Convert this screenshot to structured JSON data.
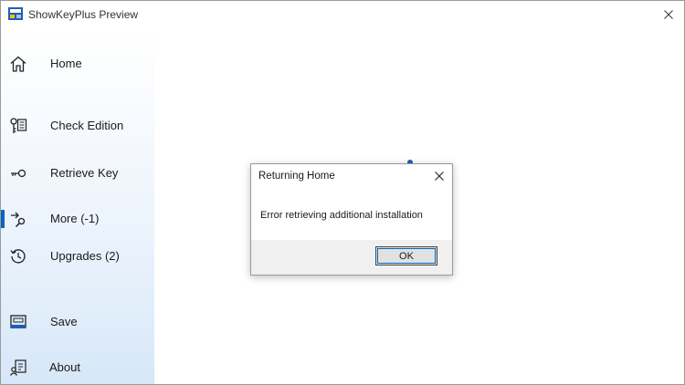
{
  "window": {
    "title": "ShowKeyPlus Preview"
  },
  "sidebar": {
    "items": [
      {
        "label": "Home",
        "icon": "home-icon"
      },
      {
        "label": "Check Edition",
        "icon": "edition-icon"
      },
      {
        "label": "Retrieve Key",
        "icon": "key-icon"
      },
      {
        "label": "More (-1)",
        "icon": "more-search-icon",
        "selected": true
      },
      {
        "label": "Upgrades (2)",
        "icon": "history-icon"
      },
      {
        "label": "Save",
        "icon": "save-icon"
      },
      {
        "label": "About",
        "icon": "about-icon"
      }
    ]
  },
  "dialog": {
    "title": "Returning Home",
    "message": "Error retrieving additional installation",
    "ok_label": "OK"
  },
  "colors": {
    "accent": "#0067c0",
    "sidebar_bottom": "#d6e7f8",
    "dialog_footer": "#f0f0f0"
  }
}
